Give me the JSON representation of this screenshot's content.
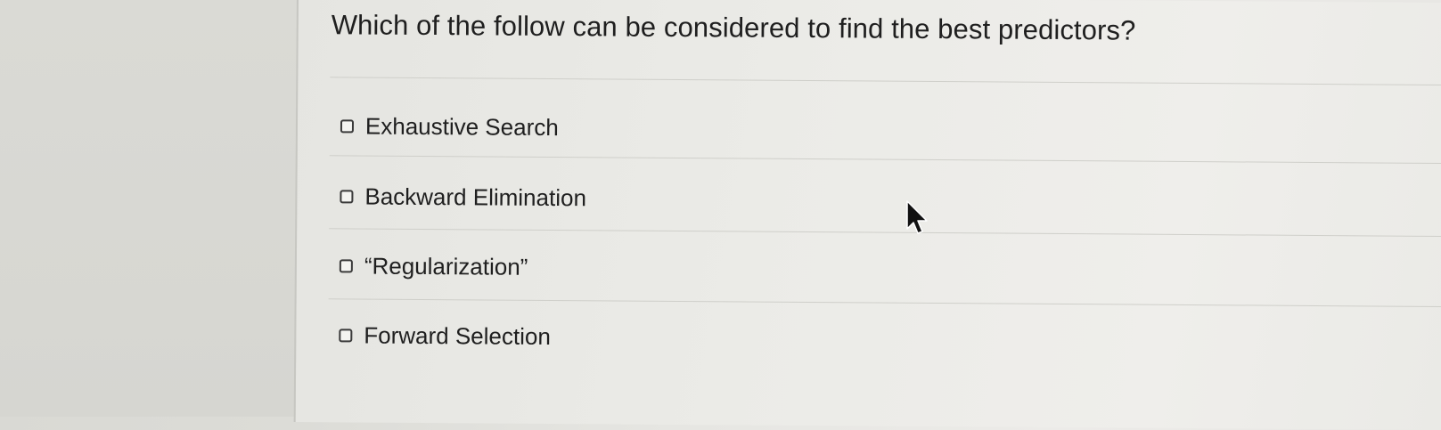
{
  "question": {
    "text": "Which of the follow can be considered to find the best predictors?"
  },
  "options": [
    {
      "label": "Exhaustive Search",
      "checked": false
    },
    {
      "label": "Backward Elimination",
      "checked": false
    },
    {
      "label": "“Regularization”",
      "checked": false
    },
    {
      "label": "Forward Selection",
      "checked": false
    }
  ],
  "cursor": {
    "icon": "mouse-pointer-icon"
  }
}
